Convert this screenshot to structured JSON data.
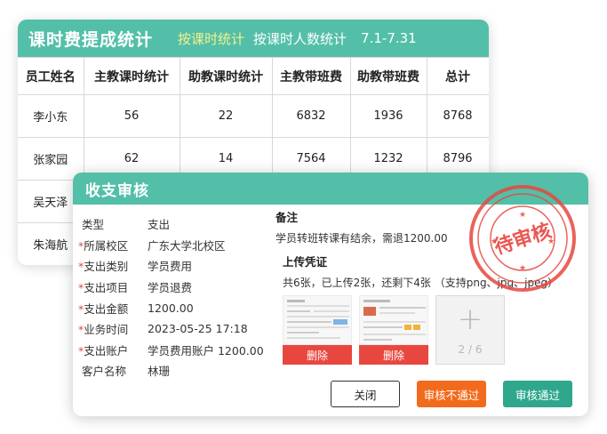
{
  "stats": {
    "title": "课时费提成统计",
    "tabs": [
      "按课时统计",
      "按课时人数统计"
    ],
    "range": "7.1-7.31",
    "columns": [
      "员工姓名",
      "主教课时统计",
      "助教课时统计",
      "主教带班费",
      "助教带班费",
      "总计"
    ],
    "rows": [
      [
        "李小东",
        "56",
        "22",
        "6832",
        "1936",
        "8768"
      ],
      [
        "张家园",
        "62",
        "14",
        "7564",
        "1232",
        "8796"
      ],
      [
        "吴天泽",
        "",
        "",
        "",
        "",
        ""
      ],
      [
        "朱海航",
        "",
        "",
        "",
        "",
        ""
      ]
    ]
  },
  "dialog": {
    "title": "收支审核",
    "fields": [
      {
        "label": "类型",
        "value": "支出",
        "required": false
      },
      {
        "label": "所属校区",
        "value": "广东大学北校区",
        "required": true
      },
      {
        "label": "支出类别",
        "value": "学员费用",
        "required": true
      },
      {
        "label": "支出项目",
        "value": "学员退费",
        "required": true
      },
      {
        "label": "支出金额",
        "value": "1200.00",
        "required": true
      },
      {
        "label": "业务时间",
        "value": "2023-05-25 17:18",
        "required": true
      },
      {
        "label": "支出账户",
        "value": "学员费用账户 1200.00",
        "required": true
      },
      {
        "label": "客户名称",
        "value": "林珊",
        "required": false
      }
    ],
    "notes_title": "备注",
    "notes_text": "学员转班转课有结余，需退1200.00",
    "upload_title": "上传凭证",
    "upload_text": "共6张，已上传2张，还剩下4张 （支持png、jpg、jpeg）",
    "delete_label": "删除",
    "add_count": "2 / 6",
    "stamp_text": "待审核",
    "buttons": {
      "close": "关闭",
      "reject": "审核不通过",
      "approve": "审核通过"
    }
  },
  "colors": {
    "accent": "#53bfa8",
    "tab_active": "#f4f08f",
    "danger": "#e8473f",
    "reject": "#f26a1b",
    "approve": "#2ea78d",
    "stamp": "#e8473f"
  }
}
